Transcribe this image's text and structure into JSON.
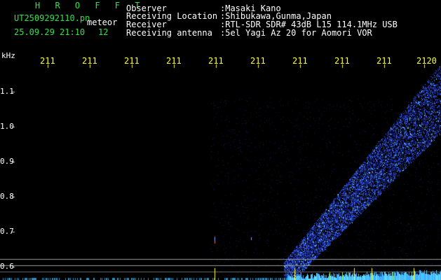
{
  "header": {
    "logo": "H R O F F T",
    "filename": "UT2509292110.pn",
    "mode": "meteor",
    "datetime": "25.09.29 21:10",
    "count": "12"
  },
  "info": {
    "observer_label": "Observer",
    "observer_value": ":Masaki Kano",
    "location_label": "Receiving Location",
    "location_value": ":Shibukawa,Gunma,Japan",
    "receiver_label": "Receiver",
    "receiver_value": ":RTL-SDR SDR# 43dB L15 114.1MHz USB",
    "antenna_label": "Receiving antenna",
    "antenna_value": ":5el Yagi Az 20 for Aomori VOR"
  },
  "axis": {
    "unit": "kHz",
    "y_ticks": [
      "1.1",
      "1.0",
      "0.9",
      "0.8",
      "0.7",
      "0.6"
    ],
    "time_ticks": [
      "211",
      "211",
      "211",
      "211",
      "211",
      "211",
      "211",
      "211",
      "211",
      "2120"
    ]
  },
  "colors": {
    "background": "#000000",
    "header_green": "#33e14a",
    "text_white": "#ffffff",
    "time_yellow": "#ffff2a",
    "signal_blue": "#2f4fff",
    "signal_cyan": "#5fd8ff"
  }
}
